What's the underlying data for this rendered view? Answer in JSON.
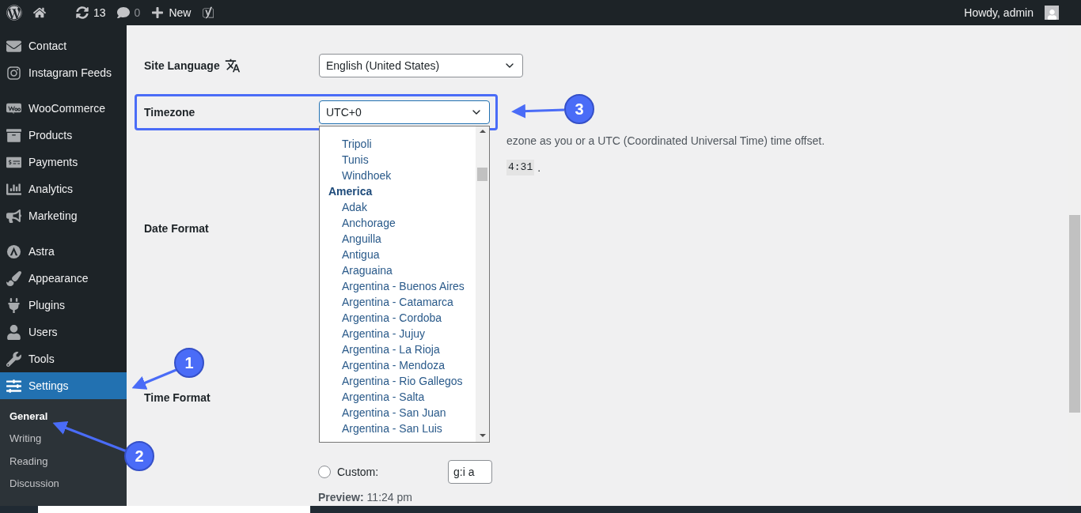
{
  "admin_bar": {
    "items": [
      {
        "kind": "logo"
      },
      {
        "kind": "home"
      },
      {
        "kind": "updates",
        "label": "13"
      },
      {
        "kind": "comments",
        "label": "0"
      },
      {
        "kind": "new",
        "label": "New"
      },
      {
        "kind": "seo"
      }
    ],
    "greeting": "Howdy, admin"
  },
  "sidebar": {
    "sections": [
      [
        {
          "label": "Contact",
          "selected": false
        },
        {
          "label": "Instagram Feeds",
          "selected": false
        }
      ],
      [
        {
          "label": "WooCommerce",
          "selected": false
        },
        {
          "label": "Products",
          "selected": false
        },
        {
          "label": "Payments",
          "selected": false
        },
        {
          "label": "Analytics",
          "selected": false
        },
        {
          "label": "Marketing",
          "selected": false
        }
      ],
      [
        {
          "label": "Astra",
          "selected": false
        },
        {
          "label": "Appearance",
          "selected": false
        },
        {
          "label": "Plugins",
          "selected": false
        },
        {
          "label": "Users",
          "selected": false
        },
        {
          "label": "Tools",
          "selected": false
        },
        {
          "label": "Settings",
          "selected": true
        }
      ]
    ],
    "submenu": [
      {
        "label": "General",
        "selected": true
      },
      {
        "label": "Writing",
        "selected": false
      },
      {
        "label": "Reading",
        "selected": false
      },
      {
        "label": "Discussion",
        "selected": false
      }
    ]
  },
  "settings": {
    "site_language": {
      "label": "Site Language",
      "value": "English (United States)"
    },
    "timezone": {
      "label": "Timezone",
      "value": "UTC+0",
      "description": "ezone as you or a UTC (Coordinated Universal Time) time offset.",
      "time_code": "4:31",
      "time_suffix": "."
    },
    "date_format": {
      "label": "Date Format"
    },
    "time_format": {
      "label": "Time Format",
      "custom_label": "Custom:",
      "custom_selected": false,
      "custom_value": "g:i a",
      "preview_label": "Preview:",
      "preview_value": "11:24 pm"
    }
  },
  "timezone_dropdown": {
    "items": [
      {
        "kind": "option",
        "label": "Tripoli"
      },
      {
        "kind": "option",
        "label": "Tunis"
      },
      {
        "kind": "option",
        "label": "Windhoek"
      },
      {
        "kind": "group",
        "label": "America"
      },
      {
        "kind": "option",
        "label": "Adak"
      },
      {
        "kind": "option",
        "label": "Anchorage"
      },
      {
        "kind": "option",
        "label": "Anguilla"
      },
      {
        "kind": "option",
        "label": "Antigua"
      },
      {
        "kind": "option",
        "label": "Araguaina"
      },
      {
        "kind": "option",
        "label": "Argentina - Buenos Aires"
      },
      {
        "kind": "option",
        "label": "Argentina - Catamarca"
      },
      {
        "kind": "option",
        "label": "Argentina - Cordoba"
      },
      {
        "kind": "option",
        "label": "Argentina - Jujuy"
      },
      {
        "kind": "option",
        "label": "Argentina - La Rioja"
      },
      {
        "kind": "option",
        "label": "Argentina - Mendoza"
      },
      {
        "kind": "option",
        "label": "Argentina - Rio Gallegos"
      },
      {
        "kind": "option",
        "label": "Argentina - Salta"
      },
      {
        "kind": "option",
        "label": "Argentina - San Juan"
      },
      {
        "kind": "option",
        "label": "Argentina - San Luis"
      }
    ]
  },
  "annotations": [
    {
      "number": "1"
    },
    {
      "number": "2"
    },
    {
      "number": "3"
    }
  ]
}
